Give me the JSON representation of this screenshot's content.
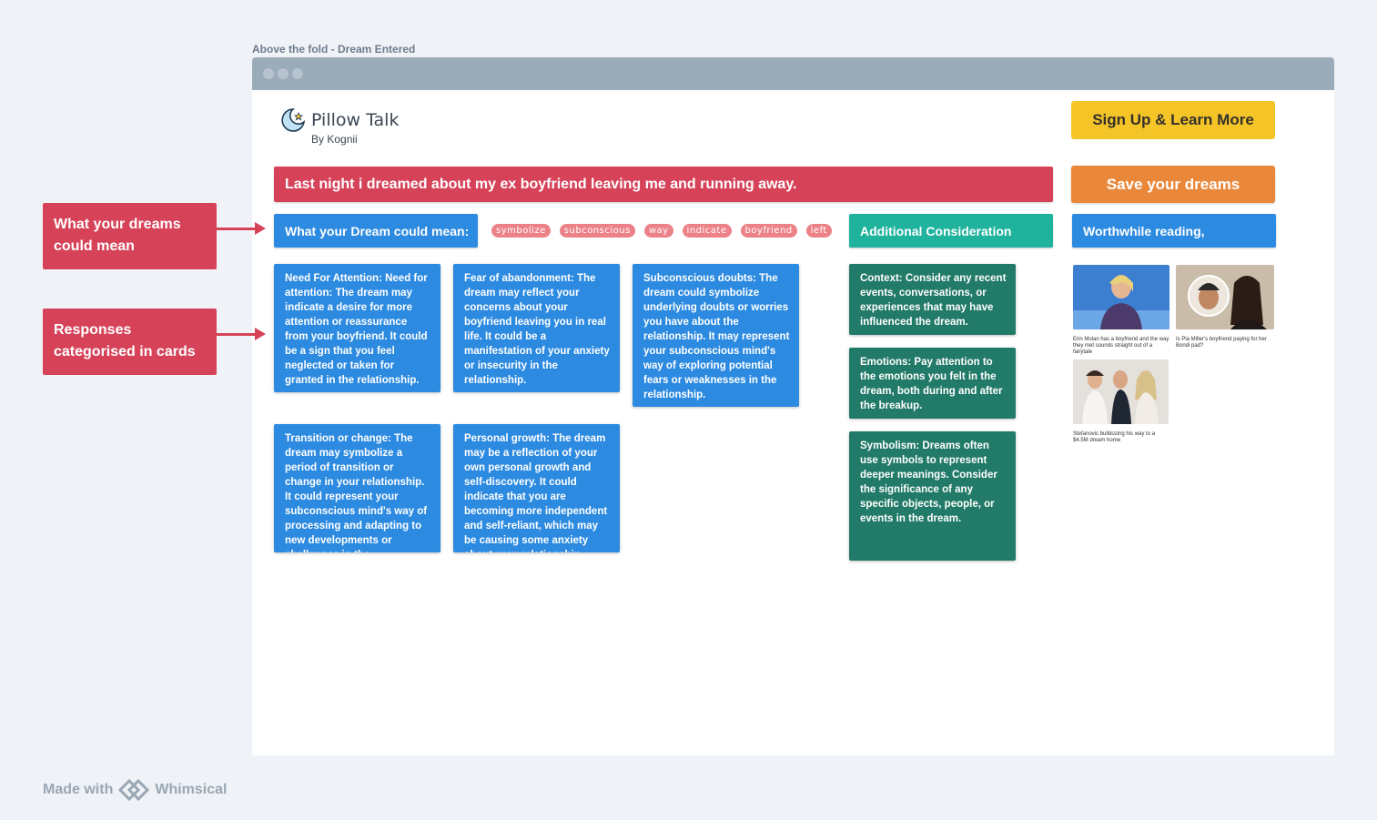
{
  "frame": {
    "label": "Above the fold - Dream Entered"
  },
  "logo": {
    "title": "Pillow Talk",
    "subtitle": "By Kognii",
    "icon": "moon-star-icon"
  },
  "header": {
    "signup_label": "Sign Up & Learn More"
  },
  "dream": {
    "text": "Last night i dreamed about my ex boyfriend leaving me and running away.",
    "save_label": "Save your dreams"
  },
  "sections": {
    "meaning_title": "What your Dream could mean:",
    "consideration_title": "Additional Consideration",
    "reading_title": "Worthwhile reading,"
  },
  "tags": [
    "symbolize",
    "subconscious",
    "way",
    "indicate",
    "boyfriend",
    "left"
  ],
  "meaning_cards": [
    {
      "heading": "",
      "body": "Need For Attention: Need for attention: The dream may indicate a desire for more attention or reassurance from your boyfriend. It could be a sign that you feel neglected or taken for granted in the relationship."
    },
    {
      "heading": "Fear of abandonment:",
      "body": " The dream may reflect your concerns about your boyfriend leaving you in real life. It could be a manifestation of your anxiety or insecurity in the relationship."
    },
    {
      "heading": "",
      "body": "Subconscious doubts: The dream could symbolize underlying doubts or worries you have about the relationship. It may represent your subconscious mind's way of exploring potential fears or weaknesses in the relationship."
    },
    {
      "heading": "Transition or change:",
      "body": " The dream may symbolize a period of transition or change in your relationship. It could represent your subconscious mind's way of processing and adapting to new developments or challenges in the relationship."
    },
    {
      "heading": "Personal growth:",
      "body": " The dream may be a reflection of your own personal growth and self-discovery. It could indicate that you are becoming more independent and self-reliant, which may be causing some anxiety about your relationship."
    }
  ],
  "consideration_cards": [
    {
      "heading": "Context:",
      "body": " Consider any recent events, conversations, or experiences that may have influenced the dream."
    },
    {
      "heading": "",
      "body": "Emotions: Pay attention to the emotions you felt in the dream, both during and after the breakup."
    },
    {
      "heading": "Symbolism:",
      "body": " Dreams often use symbols to represent deeper meanings. Consider the significance of any specific objects, people, or events in the dream."
    }
  ],
  "articles": [
    {
      "caption": "Erin Molan has a boyfriend and the way they met sounds straight out of a fairytale"
    },
    {
      "caption": "Is Pia Miller's boyfriend paying for her Bondi pad?"
    },
    {
      "caption": "Stefanovic bulldozing his way to a $4.5M dream home"
    }
  ],
  "annotations": {
    "meaning": "What your dreams could mean",
    "cards": "Responses categorised in cards"
  },
  "footer": {
    "made_with": "Made with",
    "brand": "Whimsical"
  },
  "colors": {
    "red": "#d64359",
    "blue": "#2c8ae0",
    "teal": "#1fb39d",
    "green": "#227a68",
    "yellow": "#f5c528",
    "orange": "#e9873a"
  }
}
